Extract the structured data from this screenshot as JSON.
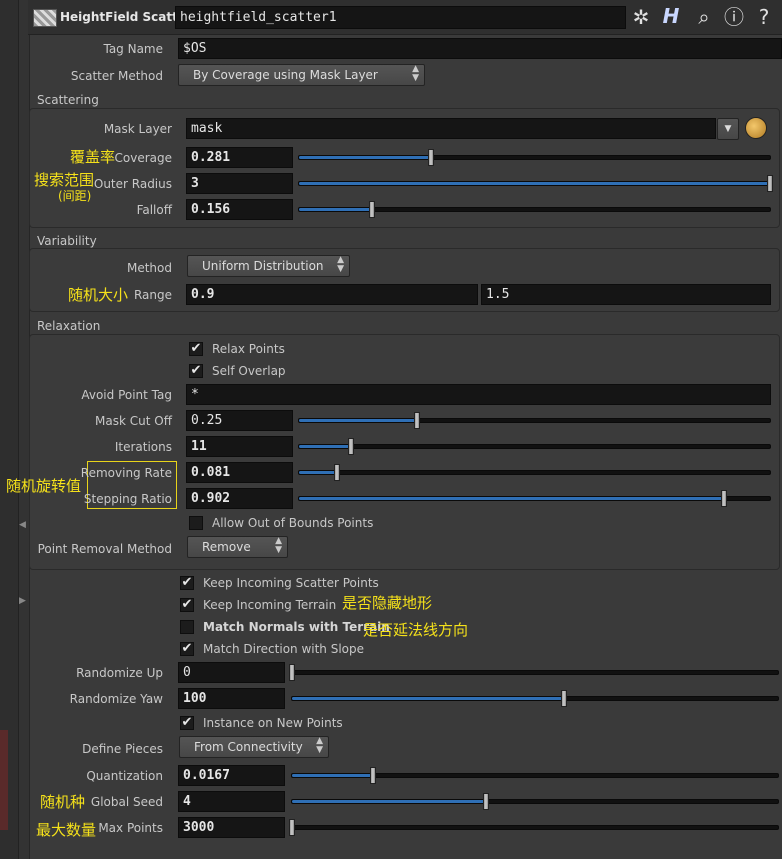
{
  "header": {
    "node_type": "HeightField Scatter",
    "node_name": "heightfield_scatter1",
    "icons": [
      "gear-icon",
      "help-h-icon",
      "search-icon",
      "info-icon",
      "help-icon"
    ]
  },
  "top": {
    "tag_name_label": "Tag Name",
    "tag_name_value": "$OS",
    "scatter_method_label": "Scatter Method",
    "scatter_method_value": "By Coverage using Mask Layer"
  },
  "scattering": {
    "title": "Scattering",
    "mask_layer_label": "Mask Layer",
    "mask_layer_value": "mask",
    "coverage_label": "Coverage",
    "coverage_value": "0.281",
    "coverage_fraction": 0.281,
    "outer_radius_label": "Outer Radius",
    "outer_radius_value": "3",
    "outer_radius_fraction": 1.0,
    "falloff_label": "Falloff",
    "falloff_value": "0.156",
    "falloff_fraction": 0.156
  },
  "variability": {
    "title": "Variability",
    "method_label": "Method",
    "method_value": "Uniform Distribution",
    "range_label": "Range",
    "range_min": "0.9",
    "range_max": "1.5"
  },
  "relaxation": {
    "title": "Relaxation",
    "relax_points_label": "Relax Points",
    "self_overlap_label": "Self Overlap",
    "avoid_point_tag_label": "Avoid Point Tag",
    "avoid_point_tag_value": "*",
    "mask_cut_off_label": "Mask Cut Off",
    "mask_cut_off_value": "0.25",
    "mask_cut_off_fraction": 0.25,
    "iterations_label": "Iterations",
    "iterations_value": "11",
    "iterations_fraction": 0.11,
    "removing_rate_label": "Removing Rate",
    "removing_rate_value": "0.081",
    "removing_rate_fraction": 0.081,
    "stepping_ratio_label": "Stepping Ratio",
    "stepping_ratio_value": "0.902",
    "stepping_ratio_fraction": 0.902,
    "allow_oob_label": "Allow Out of Bounds Points",
    "point_removal_label": "Point Removal Method",
    "point_removal_value": "Remove"
  },
  "bottom": {
    "keep_scatter_label": "Keep Incoming Scatter Points",
    "keep_terrain_label": "Keep Incoming Terrain",
    "match_normals_label": "Match Normals with Terrain",
    "match_direction_label": "Match Direction with Slope",
    "randomize_up_label": "Randomize Up",
    "randomize_up_value": "0",
    "randomize_up_fraction": 0.0,
    "randomize_yaw_label": "Randomize Yaw",
    "randomize_yaw_value": "100",
    "randomize_yaw_fraction": 0.56,
    "instance_label": "Instance on New Points",
    "define_pieces_label": "Define Pieces",
    "define_pieces_value": "From Connectivity",
    "quantization_label": "Quantization",
    "quantization_value": "0.0167",
    "quantization_fraction": 0.167,
    "global_seed_label": "Global Seed",
    "global_seed_value": "4",
    "global_seed_fraction": 0.4,
    "max_points_label": "Max Points",
    "max_points_value": "3000",
    "max_points_fraction": 0.0
  },
  "annotations": {
    "coverage": "覆盖率",
    "outer_radius": "搜索范围",
    "outer_radius_sub": "(间距)",
    "range": "随机大小",
    "random_rotation": "随机旋转值",
    "hide_terrain": "是否隐藏地形",
    "follow_normals": "是否延法线方向",
    "random_seed": "随机种",
    "max_count": "最大数量"
  }
}
